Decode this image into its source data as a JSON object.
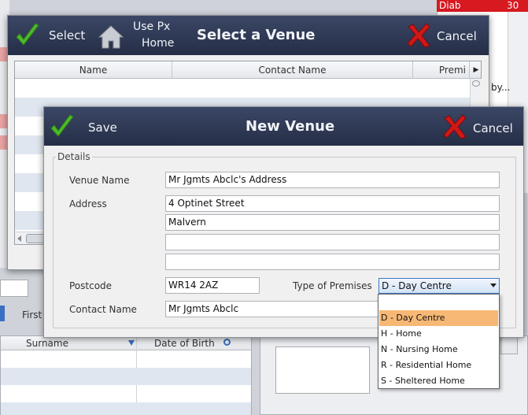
{
  "background": {
    "red_cell": "Diab",
    "red_num": "30",
    "first_label": "First",
    "by_label": "by...",
    "grid_headers": [
      "Surname",
      "Date of Birth"
    ]
  },
  "select_dialog": {
    "title": "Select a Venue",
    "select_label": "Select",
    "use_px_line1": "Use Px",
    "use_px_line2": "Home",
    "cancel_label": "Cancel",
    "columns": [
      "Name",
      "Contact Name",
      "Premi"
    ]
  },
  "new_venue": {
    "title": "New Venue",
    "save_label": "Save",
    "cancel_label": "Cancel",
    "group_label": "Details",
    "labels": {
      "venue_name": "Venue Name",
      "address": "Address",
      "postcode": "Postcode",
      "type_of_premises": "Type of Premises",
      "contact_name": "Contact Name"
    },
    "values": {
      "venue_name": "Mr Jgmts Abclc's Address",
      "address1": "4 Optinet Street",
      "address2": "Malvern",
      "address3": "",
      "address4": "",
      "postcode": "WR14 2AZ",
      "type_of_premises": "D - Day Centre",
      "contact_name": "Mr Jgmts Abclc"
    },
    "premises_options": [
      "D - Day Centre",
      "H - Home",
      "N - Nursing Home",
      "R - Residential Home",
      "S - Sheltered Home"
    ]
  },
  "colors": {
    "titlebar": "#2e3854",
    "selected_option": "#f7b875",
    "check_green": "#4cba2a",
    "cancel_red": "#d01818"
  }
}
